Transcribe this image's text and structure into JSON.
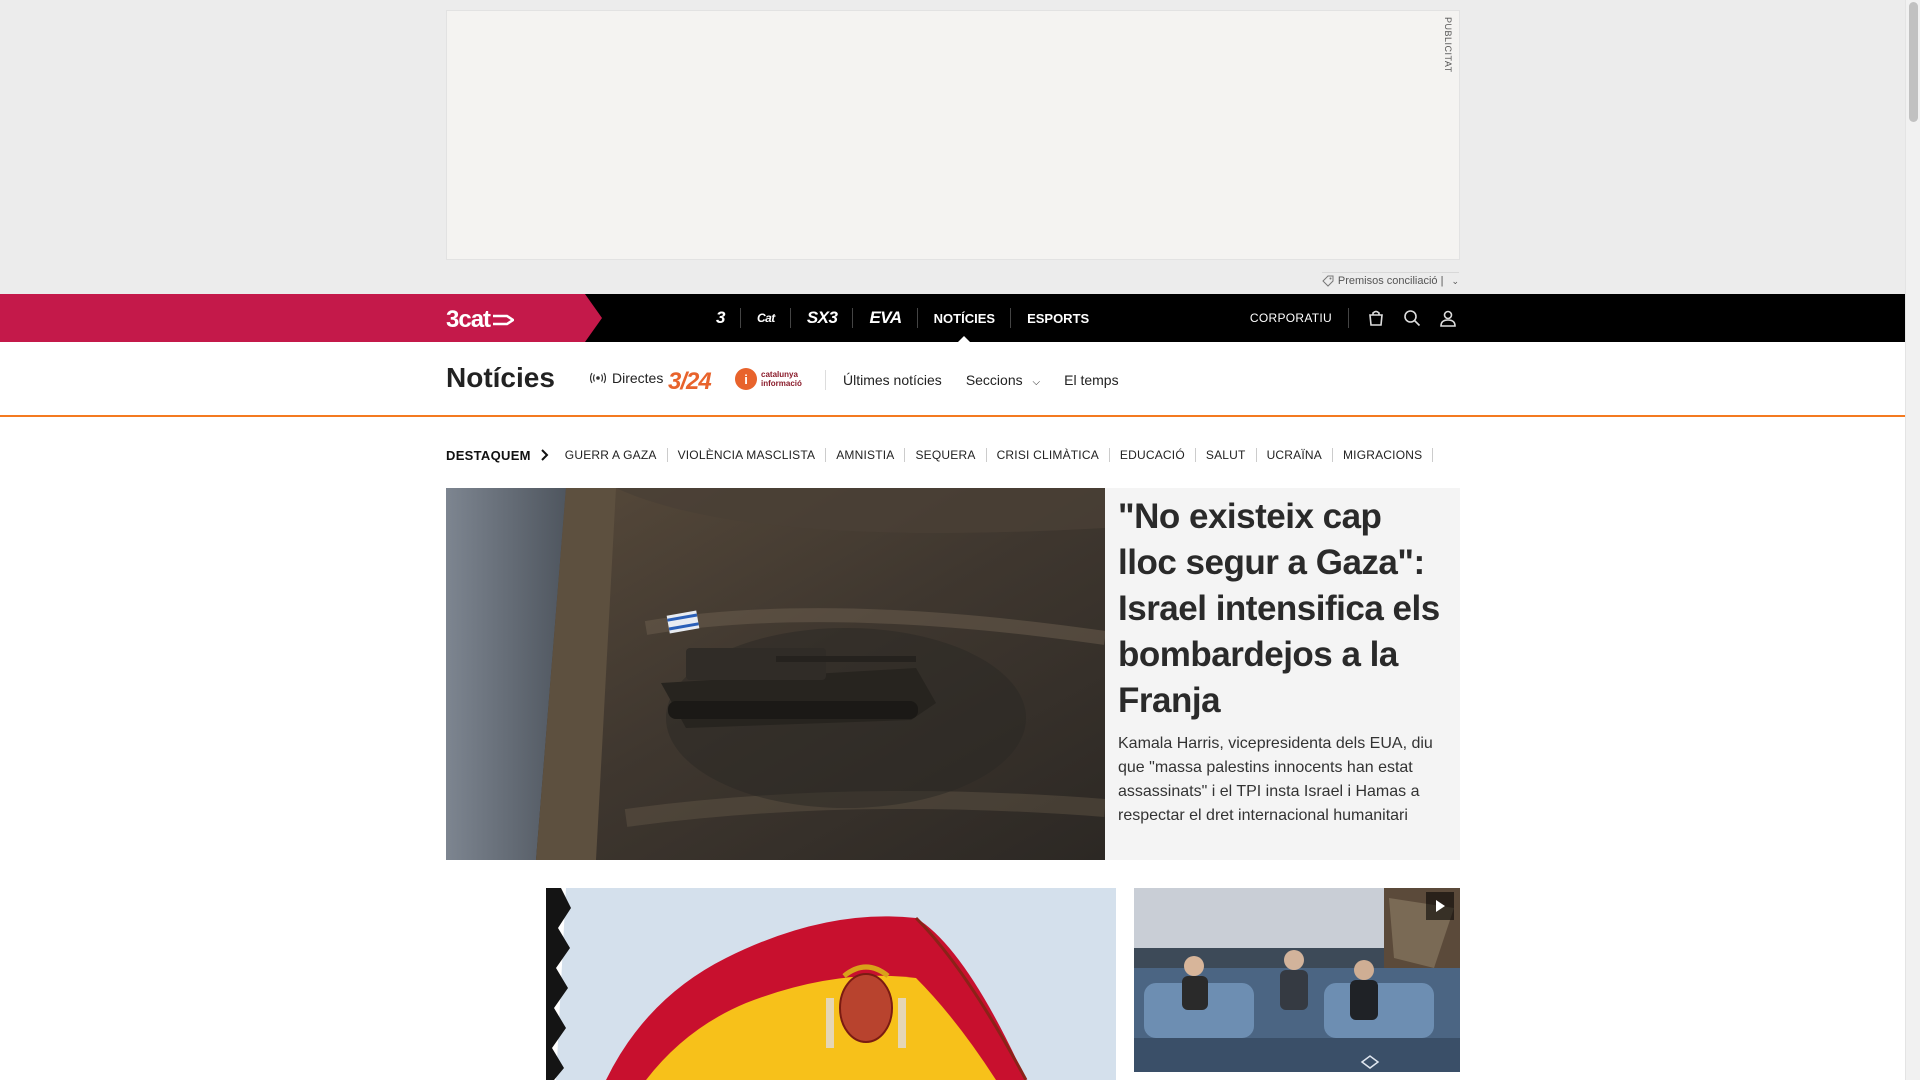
{
  "ad": {
    "tag": "PUBLICITAT",
    "note": "Premisos conciliació |"
  },
  "topnav": {
    "brand": "3cat",
    "channels": [
      {
        "label": "3",
        "icon": "tv3-logo-icon"
      },
      {
        "label": "Cat",
        "icon": "catradio-logo-icon"
      },
      {
        "label": "SX3",
        "icon": "sx3-logo-icon"
      },
      {
        "label": "EVA",
        "icon": "eva-logo-icon"
      },
      {
        "label": "NOTÍCIES",
        "active": true
      },
      {
        "label": "ESPORTS"
      }
    ],
    "corporate": "CORPORATIU",
    "icons": [
      "shop-icon",
      "search-icon",
      "user-icon"
    ]
  },
  "section": {
    "title": "Notícies",
    "directes": "Directes",
    "logo_324": "3/24",
    "logo_ci": "catalunya informació",
    "links": [
      {
        "label": "Últimes notícies"
      },
      {
        "label": "Seccions",
        "dropdown": true
      },
      {
        "label": "El temps"
      }
    ]
  },
  "destaquem": {
    "title": "DESTAQUEM",
    "tags": [
      "GUERR A GAZA",
      "VIOLÈNCIA MASCLISTA",
      "AMNISTIA",
      "SEQUERA",
      "CRISI CLIMÀTICA",
      "EDUCACIÓ",
      "SALUT",
      "UCRAÏNA",
      "MIGRACIONS"
    ]
  },
  "lead": {
    "headline": "\"No existeix cap lloc segur a Gaza\": Israel intensifica els bombardejos a la Franja",
    "subhead": "Kamala Harris, vicepresidenta dels EUA, diu que \"massa palestins innocents han estat assassinats\" i el TPI insta Israel i Hamas a respectar el dret internacional humanitari"
  },
  "colors": {
    "brand": "#c4194a",
    "nav_bg": "#000000",
    "section_accent": "#f47a20"
  }
}
